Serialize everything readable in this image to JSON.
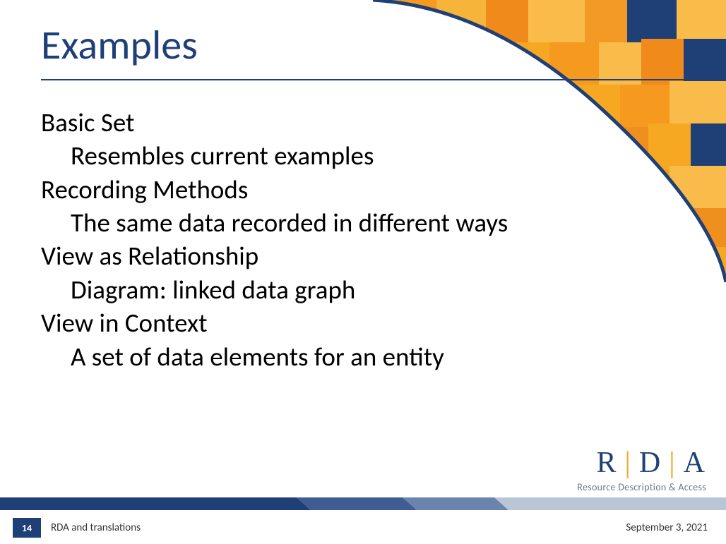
{
  "title": "Examples",
  "content": {
    "line1": "Basic Set",
    "line2": "Resembles current examples",
    "line3": "Recording Methods",
    "line4": "The same data recorded in different ways",
    "line5": "View as Relationship",
    "line6": "Diagram: linked data graph",
    "line7": "View in Context",
    "line8": "A set of data elements for an entity"
  },
  "logo": {
    "r": "R",
    "d": "D",
    "a": "A",
    "tagline": "Resource Description & Access"
  },
  "footer": {
    "page": "14",
    "doc_title": "RDA and translations",
    "date": "September 3, 2021"
  }
}
